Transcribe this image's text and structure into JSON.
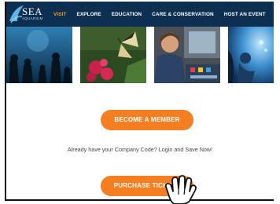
{
  "logo": {
    "name": "SEA",
    "subtitle": "AQUARIUM"
  },
  "nav": {
    "items": [
      {
        "label": "VISIT",
        "active": true
      },
      {
        "label": "EXPLORE",
        "active": false
      },
      {
        "label": "EDUCATION",
        "active": false
      },
      {
        "label": "CARE & CONSERVATION",
        "active": false
      },
      {
        "label": "HOST AN EVENT",
        "active": false
      }
    ]
  },
  "main": {
    "member_button": "BECOME A MEMBER",
    "company_code_text": "Already have your Company Code? Login and Save Now!",
    "tickets_button": "PURCHASE TICKETS"
  },
  "colors": {
    "nav_background": "#0d2f52",
    "nav_active": "#f7941d",
    "button": "#f47e20"
  },
  "icons": [
    "sea-aquarium-logo-icon",
    "hand-pointer-cursor-icon"
  ]
}
